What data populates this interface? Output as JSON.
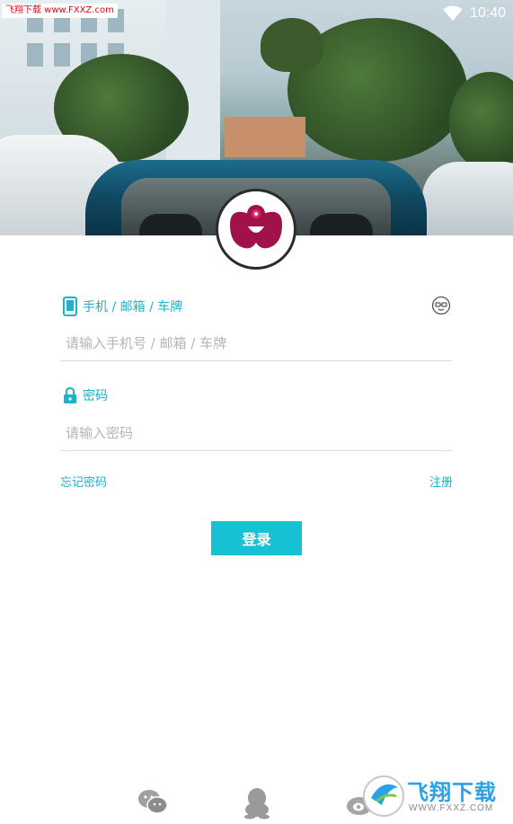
{
  "status_bar": {
    "time": "10:40",
    "wifi_icon": "wifi-icon"
  },
  "watermark_top": {
    "text": "飞翔下载 www.FXXZ.com"
  },
  "form": {
    "account_label": "手机 / 邮箱 / 车牌",
    "account_placeholder": "请输入手机号 / 邮箱 / 车牌",
    "password_label": "密码",
    "password_placeholder": "请输入密码"
  },
  "links": {
    "forgot_password": "忘记密码",
    "register": "注册"
  },
  "login_button": "登录",
  "social_icons": [
    "wechat-icon",
    "qq-icon",
    "weibo-icon"
  ],
  "watermark_bottom": {
    "text": "飞翔下载",
    "url": "WWW.FXXZ.COM"
  },
  "colors": {
    "accent": "#1ab3c7",
    "button": "#17c1d4",
    "divider": "#dcdcdc"
  }
}
